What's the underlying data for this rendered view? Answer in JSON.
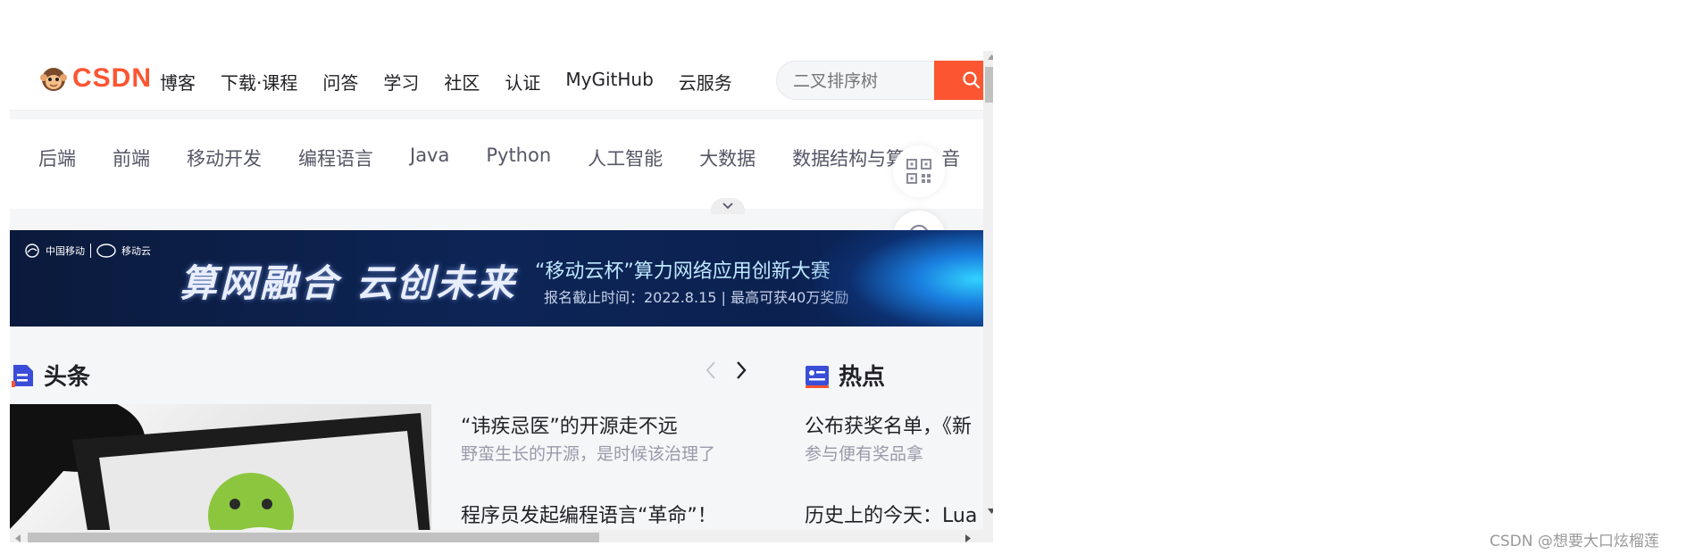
{
  "header": {
    "logo_text": "CSDN",
    "nav": [
      "博客",
      "下载·课程",
      "问答",
      "学习",
      "社区",
      "认证",
      "MyGitHub",
      "云服务"
    ],
    "search_placeholder": "二叉排序树"
  },
  "categories": [
    "后端",
    "前端",
    "移动开发",
    "编程语言",
    "Java",
    "Python",
    "人工智能",
    "大数据",
    "数据结构与算",
    "音"
  ],
  "banner": {
    "brand_cmcc": "中国移动",
    "brand_cloud": "移动云",
    "slogan": "算网融合 云创未来",
    "title": "“移动云杯”算力网络应用创新大赛",
    "subtitle": "报名截止时间：2022.8.15 | 最高可获40万奖励"
  },
  "headlines": {
    "title": "头条",
    "items": [
      {
        "title": "“讳疾忌医”的开源走不远",
        "sub": "野蛮生长的开源，是时候该治理了"
      },
      {
        "title": "程序员发起编程语言“革命”！",
        "sub": ""
      }
    ]
  },
  "hot": {
    "title": "热点",
    "items": [
      {
        "title": "公布获奖名单，《新",
        "sub": "参与便有奖品拿"
      },
      {
        "title": "历史上的今天：Lua",
        "sub": ""
      }
    ]
  },
  "watermark": "CSDN @想要大口炫榴莲",
  "colors": {
    "brand": "#fc5531",
    "headline_icon": "#3a4dd8",
    "hot_icon": "#3a4dd8"
  }
}
